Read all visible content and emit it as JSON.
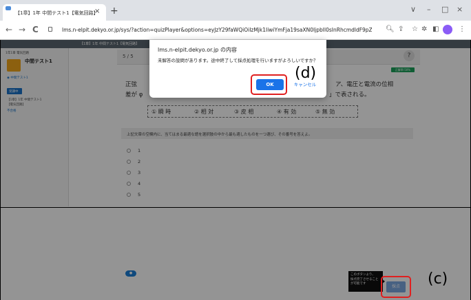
{
  "browser": {
    "tab_title": "【1章】1年 中間テスト1【電気回路】",
    "tab_close": "×",
    "new_tab": "+",
    "url": "lms.n-elpit.dekyo.or.jp/sys/?action=quizPlayer&options=eyJzY29faWQiOiIzMjk1IiwiYmFja19saXN0IjpbIl0sInRhcmdldF9pZCI6IjU0NyJ9&sid=...",
    "url_display": "lms.n-elpit.dekyo.or.jp/sys/?action=quizPlayer&options=eyJzY29faWQiOiIzMjk1IiwiYmFja19saXN0IjpbIl0sInRhcmdldF9pZCI6IjU0NyJ9...",
    "back": "←",
    "forward": "→",
    "reload": "C",
    "icons": [
      "search-icon",
      "share-icon",
      "star-icon",
      "extensions-icon",
      "sidebar-icon",
      "profile-icon",
      "menu-icon"
    ],
    "menu_dots": "⋮",
    "window_controls": [
      "∨",
      "–",
      "□",
      "×"
    ]
  },
  "app": {
    "header_text": "【1章】1年 中間テスト1【電気回路】",
    "sidebar": {
      "breadcrumb": "1年1章 電気回路",
      "course_title": "中間テスト1",
      "sub_label": "◉ 中間テスト1",
      "status_badge": "受講中",
      "item_text_1": "【1章】1年 中間テスト1",
      "item_text_2": "【電気回路】",
      "item_status": "不合格"
    },
    "question": {
      "number": "5 / 5",
      "help": "?",
      "tag": "正解率:50%",
      "line1_left": "正弦",
      "line1_right": "ア、電圧と電流の位相",
      "line2_left": "差が φ",
      "line2_right": "」で表される。",
      "choices": [
        "① 瞬 時",
        "② 相 対",
        "③ 皮 相",
        "④ 有 効",
        "⑤ 無 効"
      ],
      "instruction": "上記文章の空欄内に、当てはまる最適な語を選択肢の中から最も適したものを一つ選び、その番号を答えよ。",
      "options": [
        "1",
        "2",
        "3",
        "4",
        "5"
      ]
    },
    "bottom": {
      "pill": "●",
      "tooltip": "このボタンより、\n採点完了させること\nが可能です",
      "submit": "採点"
    }
  },
  "dialog": {
    "title": "lms.n-elpit.dekyo.or.jp の内容",
    "message": "未解答の設問があります。途中終了して採点処理を行いますがよろしいですか？",
    "ok": "OK",
    "cancel": "キャンセル"
  },
  "annotations": {
    "d": "(d)",
    "c": "(c)"
  },
  "colors": {
    "accent": "#1a73e8",
    "highlight": "#e01f1f",
    "tag_green": "#1aa05a",
    "course_orange": "#f2a51b"
  }
}
